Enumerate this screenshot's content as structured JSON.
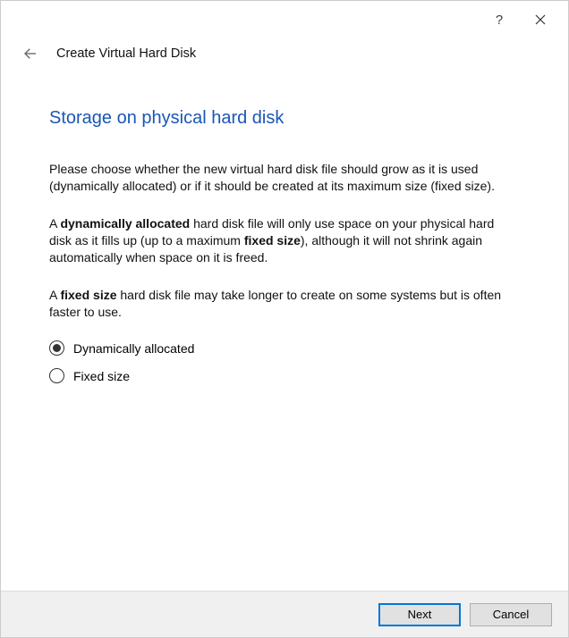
{
  "titlebar": {
    "help_symbol": "?",
    "close_label": "Close"
  },
  "header": {
    "title": "Create Virtual Hard Disk"
  },
  "page": {
    "heading": "Storage on physical hard disk",
    "p1_a": "Please choose whether the new virtual hard disk file should grow as it is used (dynamically allocated) or if it should be created at its maximum size (fixed size).",
    "p2_pre": "A ",
    "p2_b1": "dynamically allocated",
    "p2_mid": " hard disk file will only use space on your physical hard disk as it fills up (up to a maximum ",
    "p2_b2": "fixed size",
    "p2_post": "), although it will not shrink again automatically when space on it is freed.",
    "p3_pre": "A ",
    "p3_b1": "fixed size",
    "p3_post": " hard disk file may take longer to create on some systems but is often faster to use."
  },
  "options": {
    "dynamic": "Dynamically allocated",
    "fixed": "Fixed size",
    "selected": "dynamic"
  },
  "footer": {
    "next": "Next",
    "cancel": "Cancel"
  }
}
